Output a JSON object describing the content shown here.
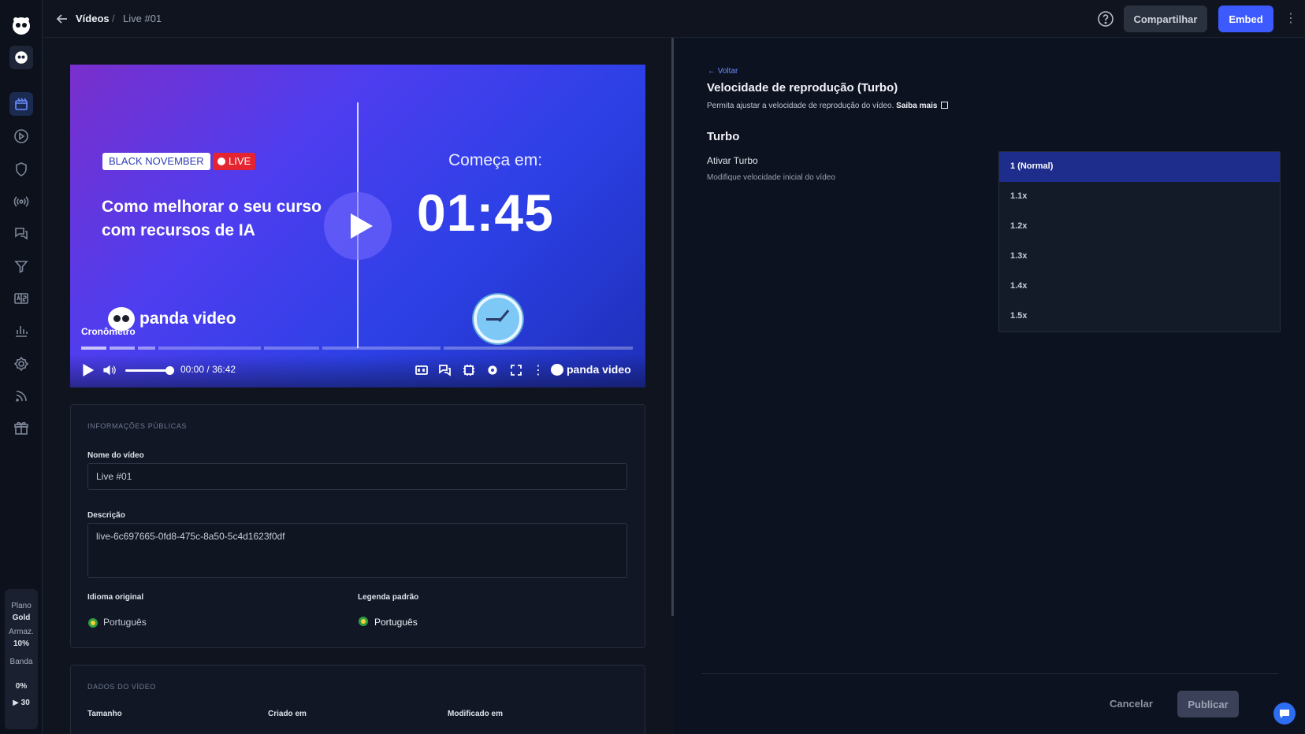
{
  "topbar": {
    "breadcrumb_parent": "Vídeos",
    "breadcrumb_separator": "/",
    "breadcrumb_current": "Live #01",
    "share_label": "Compartilhar",
    "embed_label": "Embed"
  },
  "sidebar": {
    "items": [
      "videos-icon",
      "play-icon",
      "shield-icon",
      "live-icon",
      "chat-icon",
      "filter-icon",
      "ab-test-icon",
      "analytics-icon",
      "settings-icon",
      "feed-icon",
      "gift-icon"
    ],
    "plan": {
      "plan_label": "Plano",
      "plan_value": "Gold",
      "storage_label": "Armaz.",
      "storage_value": "10%",
      "band_label": "Banda",
      "band_value": "0%",
      "extra_value": "30"
    }
  },
  "player": {
    "badge_event": "BLACK NOVEMBER",
    "badge_live": "LIVE",
    "title": "Como melhorar o seu curso com recursos de IA",
    "starts_in_label": "Começa em:",
    "countdown": "01:45",
    "watermark": "panda video",
    "chapter": "Cronômetro",
    "time_current": "00:00",
    "time_separator": "/",
    "time_total": "36:42",
    "brand": "panda video",
    "volume_level": 0.9
  },
  "public_info": {
    "heading": "INFORMAÇÕES PÚBLICAS",
    "name_label": "Nome do vídeo",
    "name_value": "Live #01",
    "description_label": "Descrição",
    "description_value": "live-6c697665-0fd8-475c-8a50-5c4d1623f0df",
    "original_lang_label": "Idioma original",
    "original_lang_value": "Português",
    "subtitle_lang_label": "Legenda padrão",
    "subtitle_lang_value": "Português"
  },
  "video_data": {
    "heading": "DADOS DO VÍDEO",
    "size_label": "Tamanho",
    "created_label": "Criado em",
    "modified_label": "Modificado em"
  },
  "turbo_panel": {
    "back_label": "← Voltar",
    "title": "Velocidade de reprodução (Turbo)",
    "description": "Permita ajustar a velocidade de reprodução do vídeo.",
    "learn_more": "Saiba mais",
    "section_title": "Turbo",
    "toggle_label": "Ativar Turbo",
    "toggle_sub": "Modifique velocidade inicial do vídeo",
    "options": [
      "1 (Normal)",
      "1.1x",
      "1.2x",
      "1.3x",
      "1.4x",
      "1.5x"
    ],
    "selected": "1 (Normal)",
    "cancel_label": "Cancelar",
    "publish_label": "Publicar"
  },
  "colors": {
    "accent": "#3d5afe",
    "selected_option": "#1e2c8c",
    "live_red": "#e52431"
  }
}
